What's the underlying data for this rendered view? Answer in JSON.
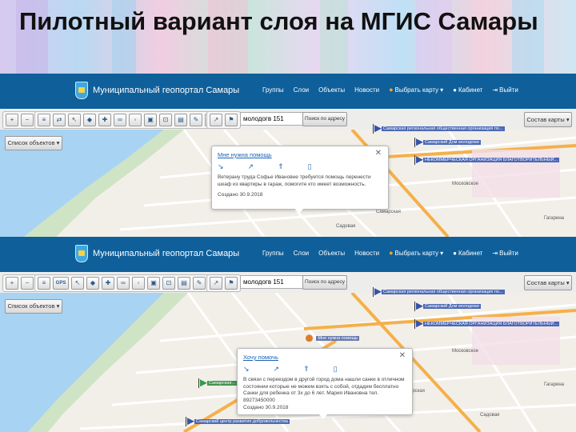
{
  "slide": {
    "title": "Пилотный вариант слоя на МГИС Самары"
  },
  "screens": [
    {
      "header": {
        "brand": "Муниципальный геопортал Самары",
        "nav": [
          "Группы",
          "Слои",
          "Объекты",
          "Новости",
          "Выбрать карту",
          "Кабинет",
          "Выйти"
        ]
      },
      "toolbar": {
        "search_value": "молодогв 151",
        "address_search_label": "Поиск по адресу",
        "layers_label": "Состав карты",
        "object_list_label": "Список объектов"
      },
      "popup": {
        "title": "Мне нужна помощь",
        "text": "Ветерану труда Софье Ивановне требуется помощь перенести шкаф из квартиры в гараж, помогите кто имеет возможность.",
        "date": "Создано 30.9.2018"
      },
      "markers": [
        "Самарская региональная общественная организация по...",
        "Самарский Дом молодежи",
        "НЕКОММЕРЧЕСКАЯ ОРГАНИЗАЦИЯ БЛАГОТВОРИТЕЛЬНЫЙ..."
      ],
      "streets": [
        "Московское",
        "Самарская",
        "Садовая",
        "Гагарина"
      ]
    },
    {
      "header": {
        "brand": "Муниципальный геопортал Самары",
        "nav": [
          "Группы",
          "Слои",
          "Объекты",
          "Новости",
          "Выбрать карту",
          "Кабинет",
          "Выйти"
        ]
      },
      "toolbar": {
        "search_value": "молодогв 151",
        "address_search_label": "Поиск по адресу",
        "layers_label": "Состав карты",
        "object_list_label": "Список объектов",
        "gps_label": "GPS"
      },
      "popup": {
        "title": "Хочу помочь",
        "text": "В связи с переездом в другой город дома нашли санки в отличном состоянии которые не можем взять с собой, отдадим бесплатно Санки для ребенка от 3х до 6 лет. Мария Ивановна тел. 89273450000",
        "date": "Создано 30.9.2018"
      },
      "help_marker": "Мне нужна помощь",
      "markers": [
        "Самарская региональная общественная организация по...",
        "Самарский Дом молодежи",
        "НЕКОММЕРЧЕСКАЯ ОРГАНИЗАЦИЯ БЛАГОТВОРИТЕЛЬНЫЙ...",
        "Самарская...",
        "Самарский центр развития добровольчества"
      ],
      "streets": [
        "Московское",
        "Самарская",
        "Садовая",
        "Гагарина"
      ]
    }
  ],
  "colors": {
    "header_bg": "#0f5f9a",
    "link": "#1b62b5",
    "river": "#a9d3f2",
    "main_road": "#f5b04a"
  }
}
